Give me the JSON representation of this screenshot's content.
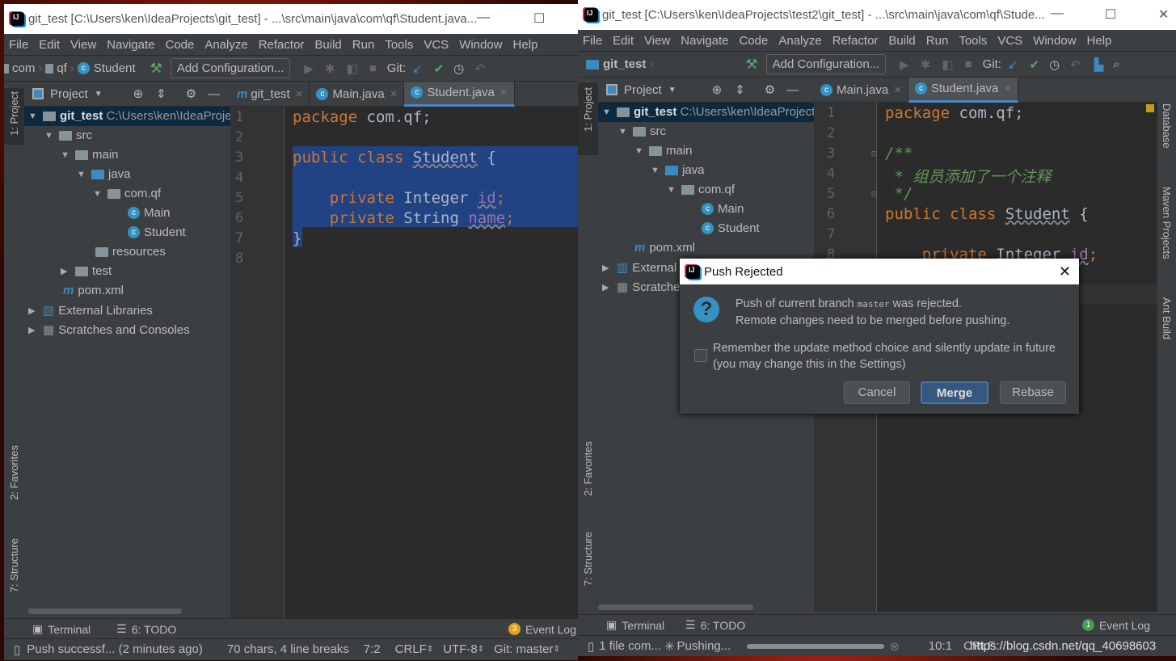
{
  "left": {
    "title": "git_test [C:\\Users\\ken\\IdeaProjects\\git_test] - ...\\src\\main\\java\\com\\qf\\Student.java...",
    "menu": [
      "File",
      "Edit",
      "View",
      "Navigate",
      "Code",
      "Analyze",
      "Refactor",
      "Build",
      "Run",
      "Tools",
      "VCS",
      "Window",
      "Help"
    ],
    "breadcrumb": [
      "com",
      "qf",
      "Student"
    ],
    "add_config": "Add Configuration...",
    "git_label": "Git:",
    "project_label": "Project",
    "tabs": [
      "git_test",
      "Main.java",
      "Student.java"
    ],
    "tree": {
      "root": "git_test",
      "root_path": "C:\\Users\\ken\\IdeaProjects\\git_test",
      "src": "src",
      "main": "main",
      "java": "java",
      "pkg": "com.qf",
      "main_cls": "Main",
      "student": "Student",
      "resources": "resources",
      "test": "test",
      "pom": "pom.xml",
      "ext": "External Libraries",
      "scratch": "Scratches and Consoles"
    },
    "code": {
      "l1a": "package",
      "l1b": " com.qf;",
      "l3a": "public class ",
      "l3b": "Student",
      "l3c": " {",
      "l5a": "    private ",
      "l5b": "Integer ",
      "l5c": "id",
      "l5d": ";",
      "l6a": "    private ",
      "l6b": "String ",
      "l6c": "name",
      "l6d": ";",
      "l7": "}"
    },
    "lines": [
      "1",
      "2",
      "3",
      "4",
      "5",
      "6",
      "7",
      "8"
    ],
    "side": {
      "project": "1: Project",
      "favorites": "2: Favorites",
      "structure": "7: Structure"
    },
    "bottom": {
      "terminal": "Terminal",
      "todo": "6: TODO",
      "event_log": "Event Log",
      "event_count": "3"
    },
    "status": {
      "msg": "Push successf... (2 minutes ago)",
      "chars": "70 chars, 4 line breaks",
      "pos": "7:2",
      "crlf": "CRLF",
      "enc": "UTF-8",
      "git": "Git: master"
    }
  },
  "right": {
    "title": "git_test [C:\\Users\\ken\\IdeaProjects\\test2\\git_test] - ...\\src\\main\\java\\com\\qf\\Stude...",
    "menu": [
      "File",
      "Edit",
      "View",
      "Navigate",
      "Code",
      "Analyze",
      "Refactor",
      "Build",
      "Run",
      "Tools",
      "VCS",
      "Window",
      "Help"
    ],
    "breadcrumb": "git_test",
    "add_config": "Add Configuration...",
    "git_label": "Git:",
    "project_label": "Project",
    "tabs": [
      "Main.java",
      "Student.java"
    ],
    "tree": {
      "root": "git_test",
      "root_path": "C:\\Users\\ken\\IdeaProjects",
      "src": "src",
      "main": "main",
      "java": "java",
      "pkg": "com.qf",
      "main_cls": "Main",
      "student": "Student",
      "pom": "pom.xml",
      "ext": "External",
      "scratch": "Scratche"
    },
    "code": {
      "l1a": "package",
      "l1b": " com.qf;",
      "l3": "/**",
      "l4": " * 组员添加了一个注释",
      "l5": " */",
      "l6a": "public class ",
      "l6b": "Student",
      "l6c": " {",
      "l8a": "    private ",
      "l8b": "Integer ",
      "l8c": "id",
      "l8d": ";"
    },
    "lines": [
      "1",
      "2",
      "3",
      "4",
      "5",
      "6",
      "7",
      "8"
    ],
    "side": {
      "project": "1: Project",
      "favorites": "2: Favorites",
      "structure": "7: Structure",
      "database": "Database",
      "maven": "Maven Projects",
      "ant": "Ant Build"
    },
    "bottom": {
      "terminal": "Terminal",
      "todo": "6: TODO",
      "event_log": "Event Log",
      "event_count": "1"
    },
    "status": {
      "msg": "1 file com...",
      "pushing": "Pushing...",
      "pos": "10:1",
      "crlf": "CRLF",
      "watermark": "https://blog.csdn.net/qq_40698603"
    }
  },
  "dialog": {
    "title": "Push Rejected",
    "msg1a": "Push of current branch ",
    "branch": "master",
    "msg1b": " was rejected.",
    "msg2": "Remote changes need to be merged before pushing.",
    "remember": "Remember the update method choice and silently update in future",
    "remember2": "(you may change this in the Settings)",
    "remember_checked": false,
    "cancel": "Cancel",
    "merge": "Merge",
    "rebase": "Rebase"
  }
}
